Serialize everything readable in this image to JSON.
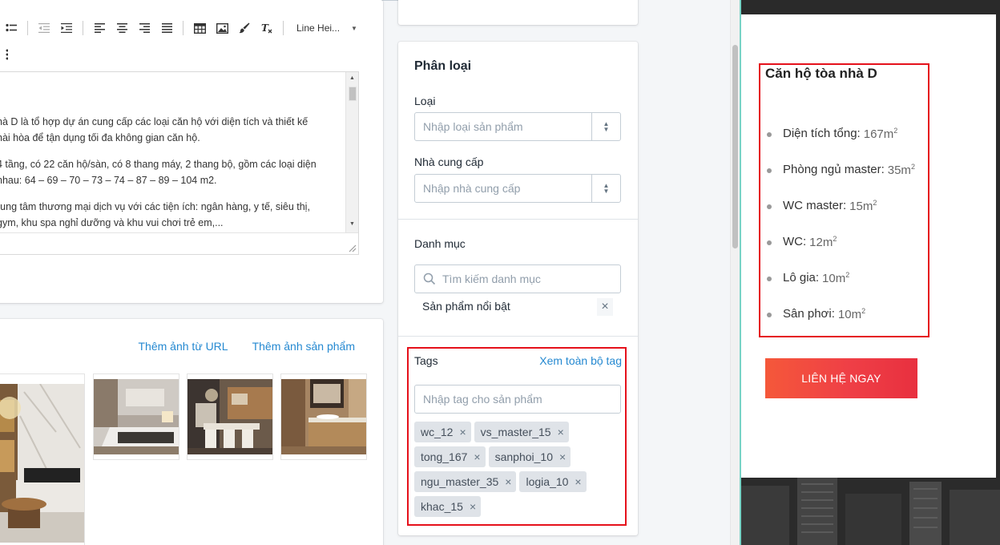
{
  "editor": {
    "toolbar": {
      "line_height_label": "Line Hei...",
      "icons": [
        "list-bullet-icon",
        "outdent-icon",
        "indent-icon",
        "align-left-icon",
        "align-center-icon",
        "align-right-icon",
        "align-justify-icon",
        "table-icon",
        "image-icon",
        "brush-icon",
        "clear-format-icon"
      ]
    },
    "paragraphs": [
      [
        "hà D  là tổ hợp dự án cung cấp các loại căn hộ với diện tích và thiết kế",
        "hài hòa để tận dụng tối đa không gian căn hộ."
      ],
      [
        "4 tầng, có 22 căn hộ/sàn, có 8 thang máy, 2 thang bộ, gồm các loại diện",
        "nhau: 64 – 69 – 70 – 73 – 74 – 87 – 89 – 104 m2."
      ],
      [
        "rung tâm thương mại dịch  vụ với các tiện ích: ngân hàng, y tế, siêu thị,",
        "gym, khu spa nghỉ dưỡng và khu vui chơi trẻ em,..."
      ]
    ]
  },
  "images": {
    "add_from_url": "Thêm ảnh từ URL",
    "add_product_image": "Thêm ảnh sản phẩm"
  },
  "classification": {
    "title": "Phân loại",
    "type_label": "Loại",
    "type_placeholder": "Nhập loại sản phẩm",
    "vendor_label": "Nhà cung cấp",
    "vendor_placeholder": "Nhập nhà cung cấp",
    "category_label": "Danh mục",
    "category_search_placeholder": "Tìm kiếm danh mục",
    "selected_category": "Sản phẩm nổi bật",
    "tags_label": "Tags",
    "view_all_tags": "Xem toàn bộ tag",
    "tag_input_placeholder": "Nhập tag cho sản phẩm",
    "tags": [
      "wc_12",
      "vs_master_15",
      "tong_167",
      "sanphoi_10",
      "ngu_master_35",
      "logia_10",
      "khac_15"
    ]
  },
  "preview": {
    "title": "Căn hộ tòa nhà D",
    "items": [
      {
        "label": "Diện tích tổng:",
        "value": "167m",
        "sup": "2"
      },
      {
        "label": "Phòng ngủ master:",
        "value": "35m",
        "sup": "2"
      },
      {
        "label": "WC master:",
        "value": "15m",
        "sup": "2"
      },
      {
        "label": "WC:",
        "value": "12m",
        "sup": "2"
      },
      {
        "label": "Lô gia:",
        "value": "10m",
        "sup": "2"
      },
      {
        "label": "Sân phơi:",
        "value": "10m",
        "sup": "2"
      }
    ],
    "cta": "LIÊN HỆ NGAY",
    "colors": {
      "highlight": "#e5111b",
      "cta_start": "#f5583a",
      "cta_end": "#e8303f",
      "link": "#2589d1"
    }
  }
}
